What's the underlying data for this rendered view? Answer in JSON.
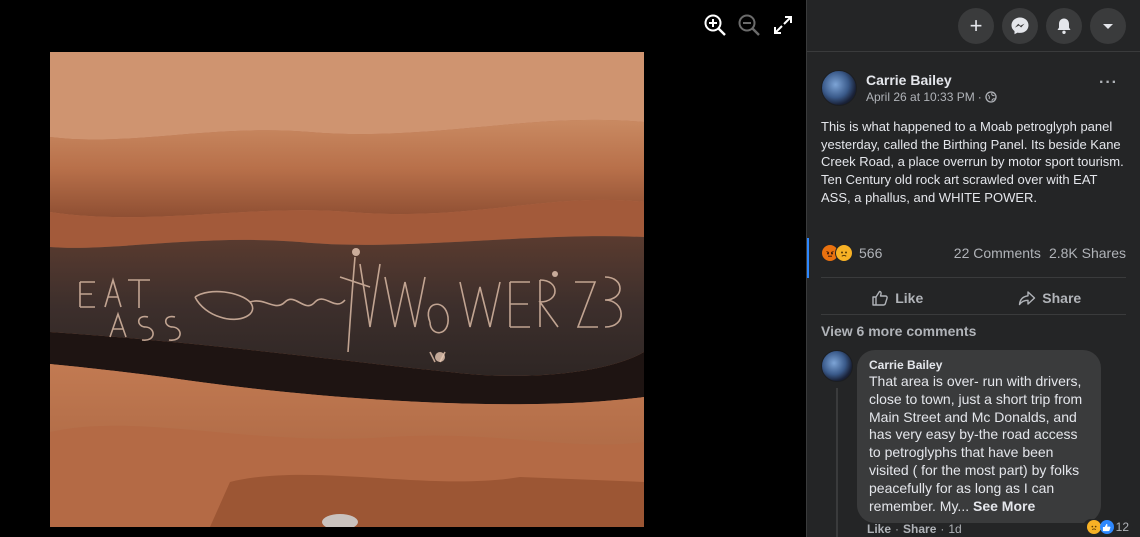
{
  "viewer": {
    "tools": [
      {
        "icon": "zoom-in-icon"
      },
      {
        "icon": "zoom-out-icon"
      },
      {
        "icon": "fullscreen-icon"
      }
    ],
    "photo": {
      "graffiti": [
        "EAT",
        "ASS",
        "WHITE POWER"
      ]
    }
  },
  "topbar": {
    "buttons": [
      "plus-icon",
      "messenger-icon",
      "bell-icon",
      "caret-down-icon"
    ]
  },
  "post": {
    "author": "Carrie Bailey",
    "date": "April 26 at 10:33 PM",
    "separator": "·",
    "privacy_icon": "globe-icon",
    "more": "···",
    "text": "This is what happened to a Moab petroglyph panel yesterday, called the Birthing Panel. Its beside Kane Creek Road, a place overrun by motor sport tourism. Ten Century old rock art scrawled over with EAT ASS, a phallus, and WHITE POWER.",
    "reaction_count": "566",
    "reaction_icons": [
      "angry-icon",
      "sad-icon"
    ],
    "comments_count": "22 Comments",
    "shares_count": "2.8K Shares",
    "like_label": "Like",
    "share_label": "Share"
  },
  "comments": {
    "view_more": "View 6 more comments",
    "items": [
      {
        "author": "Carrie Bailey",
        "text": "That area is over- run with drivers, close to town, just a short trip from Main Street and Mc Donalds, and has very easy by-the road access to petroglyphs that have been visited ( for the most part) by folks peacefully for as long as I can remember. My...",
        "see_more": "See More",
        "reaction_count": "12",
        "like": "Like",
        "reply_sep": "·",
        "share": "Share",
        "age": "1d"
      }
    ]
  },
  "colors": {
    "panel_bg": "#242526",
    "bubble_bg": "#3a3b3c",
    "text_primary": "#e4e6eb",
    "text_secondary": "#b0b3b8",
    "accent": "#2d88ff"
  }
}
